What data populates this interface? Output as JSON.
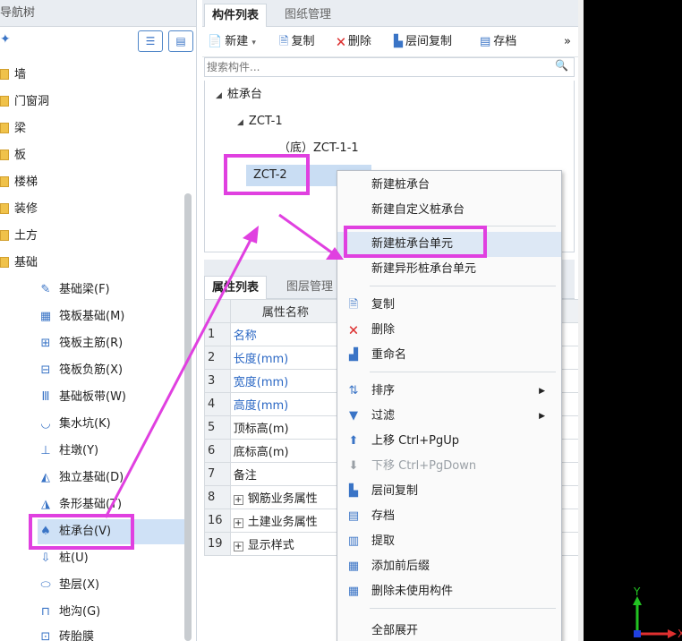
{
  "nav": {
    "title": "导航树",
    "categories": [
      "墙",
      "门窗洞",
      "梁",
      "板",
      "楼梯",
      "装修",
      "土方",
      "基础"
    ],
    "sub_items": [
      {
        "label": "基础梁(F)",
        "icon": "pencil-icon"
      },
      {
        "label": "筏板基础(M)",
        "icon": "raft-foundation-icon"
      },
      {
        "label": "筏板主筋(R)",
        "icon": "raft-main-rebar-icon"
      },
      {
        "label": "筏板负筋(X)",
        "icon": "raft-negative-rebar-icon"
      },
      {
        "label": "基础板带(W)",
        "icon": "foundation-strip-icon"
      },
      {
        "label": "集水坑(K)",
        "icon": "sump-pit-icon"
      },
      {
        "label": "柱墩(Y)",
        "icon": "column-pier-icon"
      },
      {
        "label": "独立基础(D)",
        "icon": "isolated-foundation-icon"
      },
      {
        "label": "条形基础(T)",
        "icon": "strip-foundation-icon"
      },
      {
        "label": "桩承台(V)",
        "icon": "pile-cap-icon"
      },
      {
        "label": "桩(U)",
        "icon": "pile-icon"
      },
      {
        "label": "垫层(X)",
        "icon": "cushion-icon"
      },
      {
        "label": "地沟(G)",
        "icon": "trench-icon"
      },
      {
        "label": "砖胎膜",
        "icon": "brick-mold-icon"
      }
    ]
  },
  "component_panel": {
    "tabs": [
      "构件列表",
      "图纸管理"
    ],
    "toolbar": {
      "new": "新建",
      "copy": "复制",
      "delete": "删除",
      "floor_copy": "层间复制",
      "archive": "存档",
      "more": "»"
    },
    "search_placeholder": "搜索构件...",
    "tree": {
      "root": "桩承台",
      "child": "ZCT-1",
      "grandchild": "（底）ZCT-1-1",
      "selected": "ZCT-2"
    }
  },
  "property_panel": {
    "tabs": [
      "属性列表",
      "图层管理"
    ],
    "header_col": "属性名称",
    "rows": [
      {
        "num": "1",
        "name": "名称",
        "blue": true
      },
      {
        "num": "2",
        "name": "长度(mm)",
        "blue": true
      },
      {
        "num": "3",
        "name": "宽度(mm)",
        "blue": true
      },
      {
        "num": "4",
        "name": "高度(mm)",
        "blue": true
      },
      {
        "num": "5",
        "name": "顶标高(m)",
        "blue": false
      },
      {
        "num": "6",
        "name": "底标高(m)",
        "blue": false
      },
      {
        "num": "7",
        "name": "备注",
        "blue": false
      },
      {
        "num": "8",
        "name": "钢筋业务属性",
        "blue": false,
        "expand": true
      },
      {
        "num": "16",
        "name": "土建业务属性",
        "blue": false,
        "expand": true
      },
      {
        "num": "19",
        "name": "显示样式",
        "blue": false,
        "expand": true
      }
    ]
  },
  "context_menu": {
    "new_pile_cap": "新建桩承台",
    "new_custom_pile_cap": "新建自定义桩承台",
    "new_pile_cap_unit": "新建桩承台单元",
    "new_irregular_unit": "新建异形桩承台单元",
    "copy": "复制",
    "delete": "删除",
    "rename": "重命名",
    "sort": "排序",
    "filter": "过滤",
    "move_up": "上移 Ctrl+PgUp",
    "move_down": "下移 Ctrl+PgDown",
    "floor_copy": "层间复制",
    "archive": "存档",
    "extract": "提取",
    "add_prefix_suffix": "添加前后缀",
    "delete_unused": "删除未使用构件",
    "expand_all": "全部展开"
  },
  "viewport": {
    "axis_y": "Y",
    "axis_x": "X"
  },
  "colors": {
    "highlight": "#e040e0",
    "accent": "#3a74c6",
    "selection": "#c9ddf3"
  }
}
